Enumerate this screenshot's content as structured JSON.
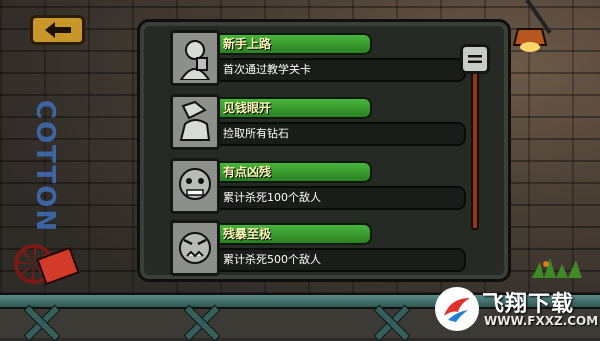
{
  "achievements": [
    {
      "title": "新手上路",
      "desc": "首次通过教学关卡",
      "icon": "thumbs-up-face-icon"
    },
    {
      "title": "见钱眼开",
      "desc": "捡取所有钻石",
      "icon": "hand-holding-diamond-icon"
    },
    {
      "title": "有点凶残",
      "desc": "累计杀死100个敌人",
      "icon": "grim-face-icon"
    },
    {
      "title": "残暴至极",
      "desc": "累计杀死500个敌人",
      "icon": "angry-face-icon"
    }
  ],
  "graffiti": "COTTON",
  "watermark": {
    "title": "飞翔下载",
    "url": "WWW.FXXZ.COM"
  },
  "colors": {
    "title_bar": "#3fa335",
    "back_button": "#c9962a",
    "scroll_track": "#8a3a1c"
  }
}
